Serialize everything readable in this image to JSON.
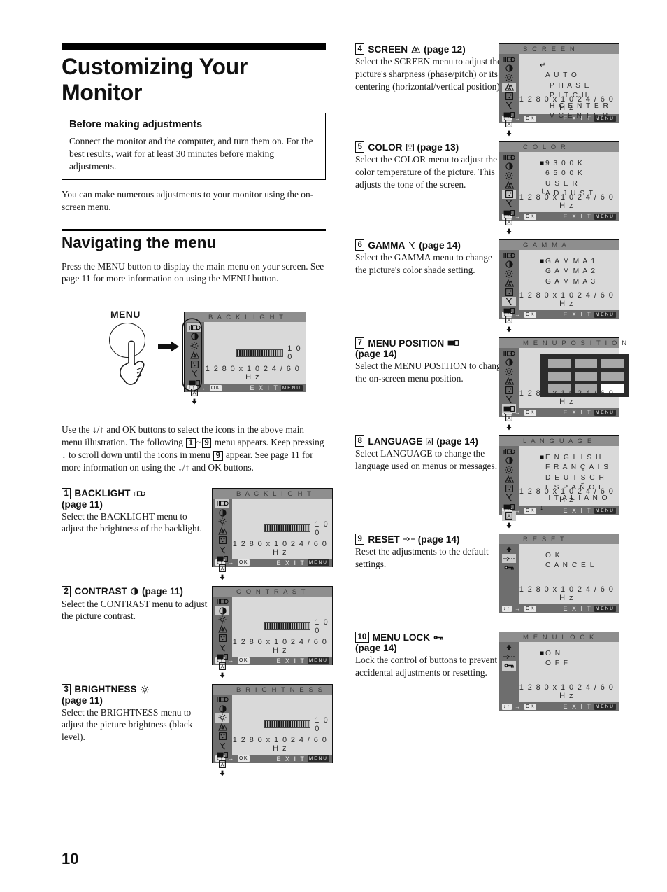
{
  "page": {
    "number": "10",
    "title": "Customizing Your Monitor"
  },
  "note": {
    "heading": "Before making adjustments",
    "body": "Connect the monitor and the computer, and turn them on. For the best results, wait for at least 30 minutes before making adjustments."
  },
  "intro": "You can make numerous adjustments to your monitor using the on-screen menu.",
  "navigating": {
    "heading": "Navigating the menu",
    "body": "Press the MENU button to display the main menu on your screen. See page 11 for more information on using the MENU button.",
    "menu_button_label": "MENU",
    "after_text_1": "Use the ",
    "after_text_2": " and OK buttons to select the icons in the above main menu illustration. The following ",
    "after_range_from": "1",
    "after_range_to": "9",
    "after_text_3": " menu appears. Keep pressing ",
    "after_text_4": " to scroll down until the icons in menu ",
    "after_menu_num": "9",
    "after_text_5": " appear. See page 11 for more information on using the ",
    "after_text_6": " and OK buttons."
  },
  "osd_common": {
    "resolution": "1 2 8 0 x 1 0 2 4 / 6 0 H z",
    "foot_ok": "OK",
    "foot_exit": "E X I T",
    "foot_menu": "MENU",
    "slider_value": "1 0 0"
  },
  "main_menu_osd": {
    "title": "B A C K L I G H T",
    "selected_icon": "backlight"
  },
  "items": [
    {
      "num": "1",
      "name": "BACKLIGHT",
      "icon": "backlight-icon",
      "page_ref": "(page 11)",
      "page_ref_inline": false,
      "desc": "Select the BACKLIGHT menu to adjust the brightness of the backlight.",
      "osd": {
        "title": "B A C K L I G H T",
        "kind": "slider",
        "selected": "backlight",
        "rail": "full"
      }
    },
    {
      "num": "2",
      "name": "CONTRAST",
      "icon": "contrast-icon",
      "page_ref": "(page 11)",
      "page_ref_inline": true,
      "desc": "Select the CONTRAST menu to adjust the picture contrast.",
      "osd": {
        "title": "C O N T R A S T",
        "kind": "slider",
        "selected": "contrast",
        "rail": "full"
      }
    },
    {
      "num": "3",
      "name": "BRIGHTNESS",
      "icon": "brightness-icon",
      "page_ref": "(page 11)",
      "page_ref_inline": false,
      "desc": "Select the BRIGHTNESS menu to adjust the picture brightness (black level).",
      "osd": {
        "title": "B R I G H T N E S S",
        "kind": "slider",
        "selected": "brightness",
        "rail": "full"
      }
    },
    {
      "num": "4",
      "name": "SCREEN",
      "icon": "screen-icon",
      "page_ref": "(page 12)",
      "page_ref_inline": true,
      "desc": "Select the SCREEN menu to adjust the picture's sharpness (phase/pitch) or its centering (horizontal/vertical position).",
      "osd": {
        "title": "S C R E E N",
        "kind": "list",
        "selected": "screen",
        "rail": "full",
        "options": [
          {
            "marker": "return",
            "label": ""
          },
          {
            "marker": "",
            "label": "A U T O"
          },
          {
            "marker": "",
            "label": "P H A S E",
            "indent": 1
          },
          {
            "marker": "",
            "label": "P I T C H",
            "indent": 1
          },
          {
            "marker": "",
            "label": "H  C E N T E R",
            "indent": 1
          },
          {
            "marker": "",
            "label": "V  C E N T E R",
            "indent": 1
          }
        ]
      }
    },
    {
      "num": "5",
      "name": "COLOR",
      "icon": "color-icon",
      "page_ref": "(page 13)",
      "page_ref_inline": true,
      "desc": "Select the COLOR menu to adjust the color temperature of the picture. This adjusts the tone of the screen.",
      "osd": {
        "title": "C O L O R",
        "kind": "list",
        "selected": "color",
        "rail": "full",
        "options": [
          {
            "marker": "selected",
            "label": "9 3 0 0 K"
          },
          {
            "marker": "",
            "label": "6 5 0 0 K"
          },
          {
            "marker": "",
            "label": "U S E R"
          },
          {
            "marker": "branch",
            "label": "A D J U S T"
          }
        ]
      }
    },
    {
      "num": "6",
      "name": "GAMMA",
      "icon": "gamma-icon",
      "page_ref": "(page 14)",
      "page_ref_inline": true,
      "desc": "Select the GAMMA menu to change the picture's color shade setting.",
      "osd": {
        "title": "G A M M A",
        "kind": "list",
        "selected": "gamma",
        "rail": "full",
        "options": [
          {
            "marker": "selected",
            "label": "G A M M A  1"
          },
          {
            "marker": "",
            "label": "G A M M A  2"
          },
          {
            "marker": "",
            "label": "G A M M A  3"
          }
        ]
      }
    },
    {
      "num": "7",
      "name": "MENU POSITION",
      "icon": "menu-position-icon",
      "page_ref": "(page 14)",
      "page_ref_inline": false,
      "desc": "Select the MENU POSITION to change the on-screen menu position.",
      "osd": {
        "title": "M E N U   P O S I T I O N",
        "kind": "grid",
        "selected": "menuposition",
        "rail": "full",
        "grid_cells": 9,
        "grid_active_index": 8
      }
    },
    {
      "num": "8",
      "name": "LANGUAGE",
      "icon": "language-icon",
      "page_ref": "(page 14)",
      "page_ref_inline": true,
      "desc": "Select LANGUAGE to change the language used on menus or messages.",
      "osd": {
        "title": "L A N G U A G E",
        "kind": "list",
        "selected": "language",
        "rail": "full",
        "options": [
          {
            "marker": "selected",
            "label": "E N G L I S H"
          },
          {
            "marker": "",
            "label": "F R A N Ç A I S"
          },
          {
            "marker": "",
            "label": "D E U T S C H"
          },
          {
            "marker": "",
            "label": "E S P A Ñ O L"
          },
          {
            "marker": "",
            "label": " I T A L I A N O"
          },
          {
            "marker": "arrow",
            "label": ""
          }
        ]
      }
    },
    {
      "num": "9",
      "name": "RESET",
      "icon": "reset-icon",
      "page_ref": "(page 14)",
      "page_ref_inline": true,
      "desc": "Reset the adjustments to the default settings.",
      "osd": {
        "title": "R E S E T",
        "kind": "list",
        "selected": "reset",
        "rail": "short",
        "options": [
          {
            "marker": "",
            "label": "O K"
          },
          {
            "marker": "",
            "label": "C A N C E L"
          }
        ]
      }
    },
    {
      "num": "10",
      "name": "MENU LOCK",
      "icon": "menu-lock-icon",
      "page_ref": "(page 14)",
      "page_ref_inline": false,
      "desc": "Lock the control of buttons to prevent accidental adjustments or resetting.",
      "osd": {
        "title": "M E N U  L O C K",
        "kind": "list",
        "selected": "menulock",
        "rail": "short",
        "options": [
          {
            "marker": "selected",
            "label": "O N"
          },
          {
            "marker": "",
            "label": "O F F"
          }
        ]
      }
    }
  ]
}
